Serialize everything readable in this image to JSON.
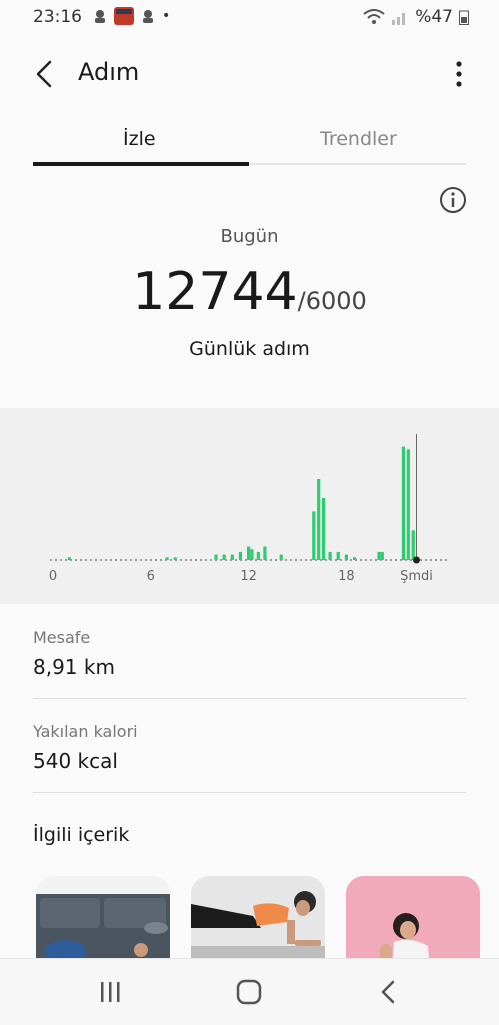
{
  "status_bar": {
    "time": "23:16",
    "battery": "%47"
  },
  "app_bar": {
    "title": "Adım"
  },
  "tabs": [
    {
      "label": "İzle",
      "active": true
    },
    {
      "label": "Trendler",
      "active": false
    }
  ],
  "summary": {
    "period": "Bugün",
    "steps": "12744",
    "goal": "/6000",
    "steps_label": "Günlük adım"
  },
  "chart_data": {
    "type": "bar",
    "x_tick_labels": [
      "0",
      "6",
      "12",
      "18",
      "Şmdi"
    ],
    "x_unit": "hour of day",
    "series": [
      {
        "color": "#2ecc71",
        "values": [
          [
            1,
            1
          ],
          [
            7,
            1
          ],
          [
            7.5,
            1
          ],
          [
            10,
            2
          ],
          [
            10.5,
            2
          ],
          [
            11,
            2
          ],
          [
            11.5,
            3
          ],
          [
            12,
            5
          ],
          [
            12.2,
            4
          ],
          [
            12.6,
            3
          ],
          [
            13,
            5
          ],
          [
            14,
            2
          ],
          [
            16,
            18
          ],
          [
            16.3,
            30
          ],
          [
            16.6,
            23
          ],
          [
            17,
            3
          ],
          [
            17.5,
            3
          ],
          [
            18,
            2
          ],
          [
            18.5,
            1
          ],
          [
            20,
            3
          ],
          [
            20.2,
            3
          ],
          [
            21.5,
            42
          ],
          [
            21.8,
            41
          ],
          [
            22.1,
            11
          ]
        ]
      }
    ],
    "now_hour": 22.3,
    "bar_color": "#2ecc71"
  },
  "stats": [
    {
      "label": "Mesafe",
      "value": "8,91 km"
    },
    {
      "label": "Yakılan kalori",
      "value": "540 kcal"
    }
  ],
  "related": {
    "title": "İlgili içerik"
  },
  "icons": {
    "back": "back-arrow-icon",
    "more": "more-vertical-icon",
    "info": "info-icon"
  }
}
